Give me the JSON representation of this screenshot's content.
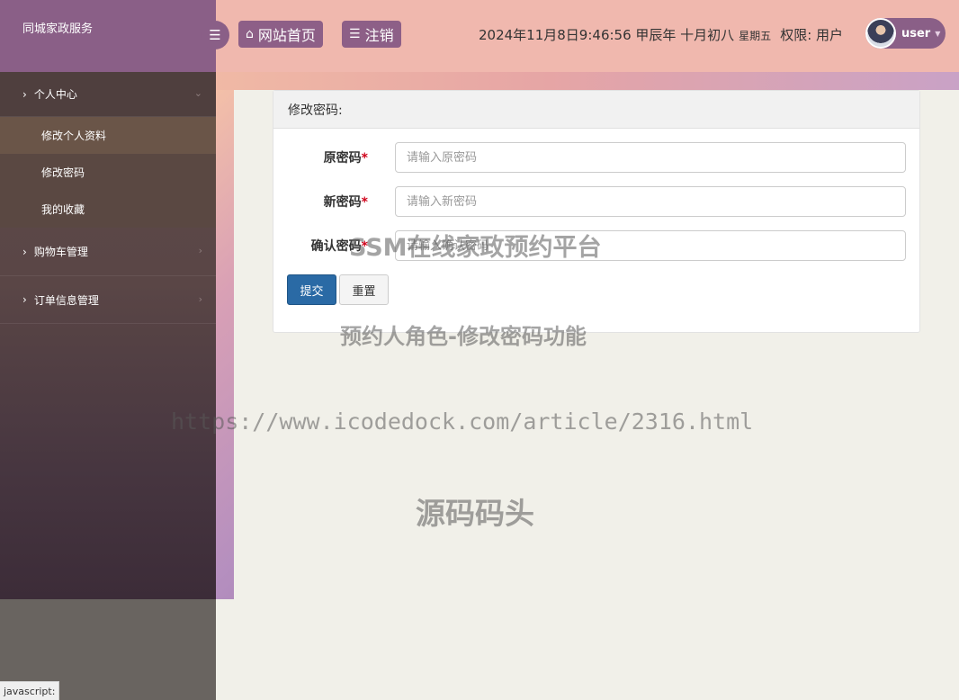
{
  "brand": {
    "title": "同城家政服务"
  },
  "header": {
    "home_label": "网站首页",
    "logout_label": "注销",
    "datetime": "2024年11月8日9:46:56 甲辰年 十月初八",
    "weekday": "星期五",
    "permission": "权限: 用户",
    "user_name": "user",
    "icons": {
      "toggle": "menu-icon",
      "home": "home-icon",
      "logout": "list-icon"
    }
  },
  "sidebar": {
    "groups": [
      {
        "label": "个人中心",
        "items": [
          {
            "label": "修改个人资料"
          },
          {
            "label": "修改密码"
          },
          {
            "label": "我的收藏"
          }
        ]
      },
      {
        "label": "购物车管理"
      },
      {
        "label": "订单信息管理"
      }
    ]
  },
  "panel": {
    "title": "修改密码:",
    "fields": [
      {
        "label": "原密码",
        "placeholder": "请输入原密码",
        "value": ""
      },
      {
        "label": "新密码",
        "placeholder": "请输入新密码",
        "value": ""
      },
      {
        "label": "确认密码",
        "placeholder": "请输入确认密码",
        "value": ""
      }
    ],
    "required_mark": "*",
    "submit_label": "提交",
    "reset_label": "重置"
  },
  "watermark": {
    "line1": "SSM在线家政预约平台",
    "line2": "预约人角色-修改密码功能",
    "line3": "https://www.icodedock.com/article/2316.html",
    "line4": "源码码头"
  },
  "statusbar": {
    "text": "javascript:"
  },
  "colors": {
    "header_bg": "#f0b8ae",
    "brand_bg": "#8a5f87",
    "sidebar_bg": "#5a4646",
    "primary_button": "#2a6aa5"
  }
}
